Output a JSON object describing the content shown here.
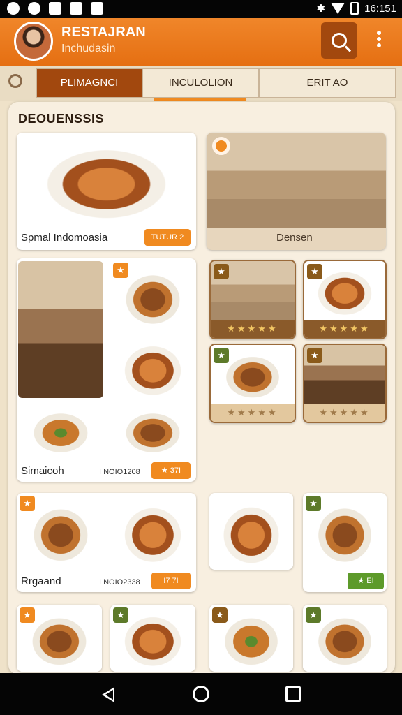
{
  "status_bar": {
    "time": "16:151"
  },
  "app_bar": {
    "title": "RESTAJRAN",
    "subtitle": "Inchudasin"
  },
  "tabs": [
    {
      "label": "PLIMAGNCI"
    },
    {
      "label": "INCULOLION"
    },
    {
      "label": "ERIT AO"
    }
  ],
  "section": {
    "title": "DEOUENSSIS"
  },
  "featured": {
    "left": {
      "label": "Spmal Indomoasia",
      "price": "TUTUR 2"
    },
    "right": {
      "label": "Densen"
    }
  },
  "grid": {
    "card_a": {
      "label": "Simaicoh",
      "price_text": "I NOIO1208",
      "price": "★ 37I"
    },
    "card_b": {
      "label": "Rrgaand",
      "price_text": "I NOIO2338",
      "price": "I7 7I"
    },
    "green_pill": "★ EI"
  },
  "ratings": [
    "★★★★★",
    "★★★★★",
    "★★★★★",
    "★★★★★"
  ],
  "colors": {
    "accent": "#f08a20",
    "app_bar": "#e97a1c",
    "active_tab": "#a2480e",
    "background": "#efe2c9"
  }
}
